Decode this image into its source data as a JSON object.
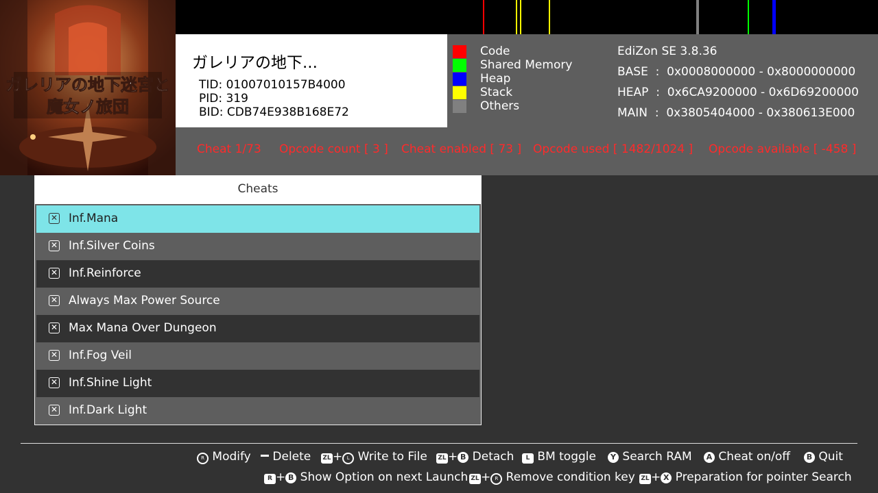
{
  "memory_colors": {
    "code": "#ff0000",
    "shared": "#00ff00",
    "heap": "#0000ff",
    "stack": "#ffff00",
    "others": "#808080"
  },
  "game": {
    "icon_art_text": "ガレリアの地下迷宮と魔女ノ旅団",
    "title": "ガレリアの地下...",
    "tid": "TID: 01007010157B4000",
    "pid": "PID: 319",
    "bid": "BID: CDB74E938B168E72"
  },
  "legend": [
    "Code",
    "Shared Memory",
    "Heap",
    "Stack",
    "Others"
  ],
  "app": {
    "version": "EdiZon SE 3.8.36",
    "base": "BASE  :  0x0008000000 - 0x8000000000",
    "heap": "HEAP  :  0x6CA9200000 - 0x6D69200000",
    "main": "MAIN  :  0x3805404000 - 0x380613E000"
  },
  "status": {
    "cheat": "Cheat 1/73",
    "opcode_count": "Opcode count [ 3 ]",
    "cheat_enabled": "Cheat enabled [ 73 ]",
    "opcode_used": "Opcode used [ 1482/1024 ]",
    "opcode_available": "Opcode available [ -458 ]"
  },
  "cheats": {
    "header": "Cheats",
    "checkbox_glyph": "✕",
    "items": [
      "Inf.Mana",
      "Inf.Silver Coins",
      "Inf.Reinforce",
      "Always Max Power Source",
      "Max Mana Over Dungeon",
      "Inf.Fog Veil",
      "Inf.Shine Light",
      "Inf.Dark Light"
    ]
  },
  "hints": {
    "modify": "Modify",
    "delete": "Delete",
    "write_to_file": "Write to File",
    "detach": "Detach",
    "bm_toggle": "BM toggle",
    "search_ram": "Search RAM",
    "cheat_onoff": "Cheat on/off",
    "quit": "Quit",
    "show_option": "Show Option on next Launch",
    "remove_condition": "Remove condition key",
    "prep_pointer": "Preparation for pointer Search"
  },
  "buttons": {
    "zl": "ZL",
    "l": "L",
    "r": "R",
    "a": "A",
    "b": "B",
    "x": "X",
    "y": "Y",
    "plus": "+"
  }
}
